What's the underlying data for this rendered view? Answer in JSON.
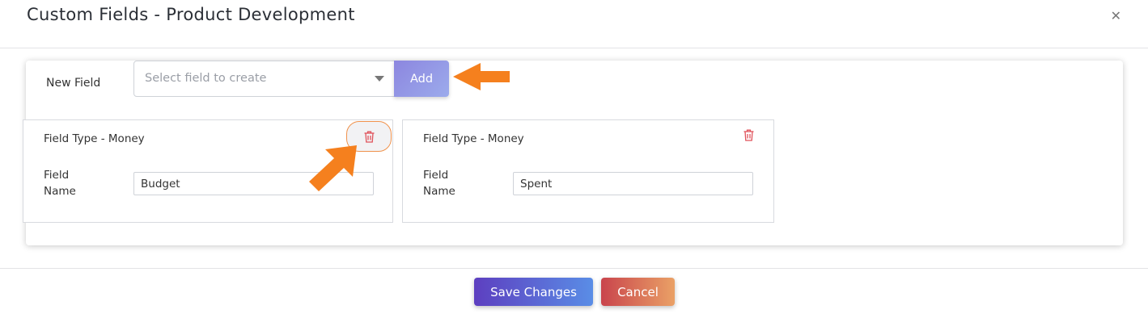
{
  "modal": {
    "title": "Custom Fields - Product Development",
    "close_icon": "close-icon"
  },
  "new_field": {
    "label": "New Field",
    "select_placeholder": "Select field to create",
    "add_label": "Add"
  },
  "fields": [
    {
      "type_label": "Field Type - Money",
      "name_label": "Field Name",
      "value": "Budget"
    },
    {
      "type_label": "Field Type - Money",
      "name_label": "Field Name",
      "value": "Spent"
    }
  ],
  "footer": {
    "save_label": "Save Changes",
    "cancel_label": "Cancel"
  },
  "colors": {
    "accent_arrow": "#f5801e",
    "delete_icon": "#e0525a",
    "add_button": "#8c86df",
    "save_button": "#5d3fc0",
    "cancel_button": "#c9444c"
  },
  "icons": {
    "delete": "trash-icon",
    "dropdown": "chevron-down-icon",
    "annotation": "arrow-icon"
  }
}
